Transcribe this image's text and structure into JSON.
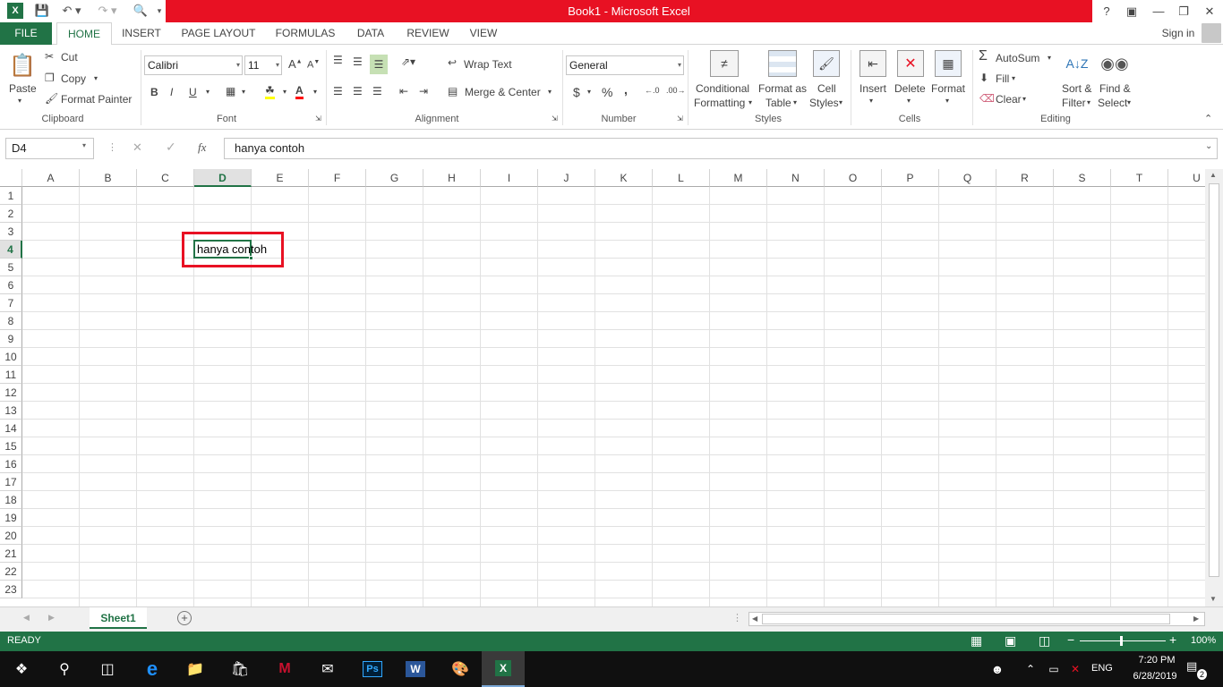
{
  "window": {
    "title": "Book1 - Microsoft Excel"
  },
  "title_controls": {
    "help": "?",
    "signin": "Sign in"
  },
  "tabs": [
    {
      "label": "FILE"
    },
    {
      "label": "HOME"
    },
    {
      "label": "INSERT"
    },
    {
      "label": "PAGE LAYOUT"
    },
    {
      "label": "FORMULAS"
    },
    {
      "label": "DATA"
    },
    {
      "label": "REVIEW"
    },
    {
      "label": "VIEW"
    }
  ],
  "ribbon": {
    "clipboard": {
      "paste": "Paste",
      "cut": "Cut",
      "copy": "Copy",
      "format_painter": "Format Painter",
      "label": "Clipboard"
    },
    "font": {
      "name": "Calibri",
      "size": "11",
      "bold": "B",
      "italic": "I",
      "underline": "U",
      "label": "Font"
    },
    "alignment": {
      "wrap": "Wrap Text",
      "merge": "Merge & Center",
      "label": "Alignment"
    },
    "number": {
      "format": "General",
      "currency": "$",
      "percent": "%",
      "comma": ",",
      "label": "Number"
    },
    "styles": {
      "conditional1": "Conditional",
      "conditional2": "Formatting",
      "table1": "Format as",
      "table2": "Table",
      "cell1": "Cell",
      "cell2": "Styles",
      "label": "Styles"
    },
    "cells": {
      "insert": "Insert",
      "delete": "Delete",
      "format": "Format",
      "label": "Cells"
    },
    "editing": {
      "autosum": "AutoSum",
      "fill": "Fill",
      "clear": "Clear",
      "sort1": "Sort &",
      "sort2": "Filter",
      "find1": "Find &",
      "find2": "Select",
      "label": "Editing"
    }
  },
  "formula_bar": {
    "name_box": "D4",
    "fx": "fx",
    "content": "hanya contoh"
  },
  "grid": {
    "columns": [
      "A",
      "B",
      "C",
      "D",
      "E",
      "F",
      "G",
      "H",
      "I",
      "J",
      "K",
      "L",
      "M",
      "N",
      "O",
      "P",
      "Q",
      "R",
      "S",
      "T",
      "U"
    ],
    "rows": [
      "1",
      "2",
      "3",
      "4",
      "5",
      "6",
      "7",
      "8",
      "9",
      "10",
      "11",
      "12",
      "13",
      "14",
      "15",
      "16",
      "17",
      "18",
      "19",
      "20",
      "21",
      "22",
      "23"
    ],
    "selected_col": "D",
    "selected_row": "4",
    "cell_d4": "hanya contoh",
    "highlight_color": "#e81123"
  },
  "sheets": [
    {
      "name": "Sheet1"
    }
  ],
  "status": {
    "ready": "READY",
    "zoom": "100%"
  },
  "taskbar": {
    "lang": "ENG",
    "time": "7:20 PM",
    "date": "6/28/2019",
    "notif_count": "2"
  },
  "colors": {
    "excel_green": "#217346",
    "title_red": "#e81123"
  }
}
